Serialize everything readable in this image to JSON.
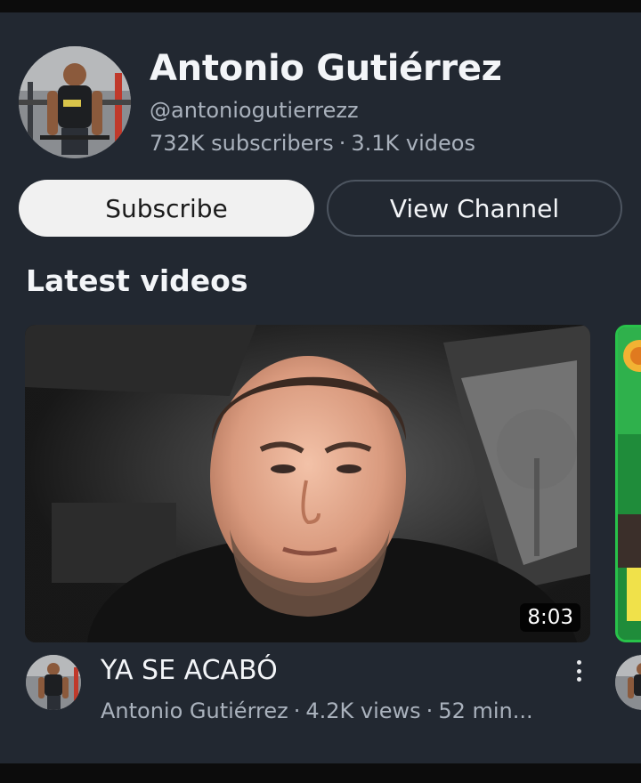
{
  "channel": {
    "name": "Antonio Gutiérrez",
    "handle": "@antoniogutierrezz",
    "subscribers": "732K subscribers",
    "separator": "·",
    "videos_count": "3.1K videos",
    "avatar_icon": "channel-avatar"
  },
  "buttons": {
    "subscribe_label": "Subscribe",
    "view_channel_label": "View Channel"
  },
  "latest": {
    "title": "Latest videos",
    "videos": [
      {
        "title": "YA SE ACABÓ",
        "channel": "Antonio Gutiérrez",
        "views": "4.2K views",
        "age": "52 min...",
        "duration": "8:03",
        "more_icon": "more-vert-icon"
      }
    ]
  },
  "colors": {
    "card_bg": "#222831",
    "subscribe_bg": "#f1f1f1",
    "secondary_text": "#aab2bd",
    "next_thumb_accent": "#28c24a"
  }
}
